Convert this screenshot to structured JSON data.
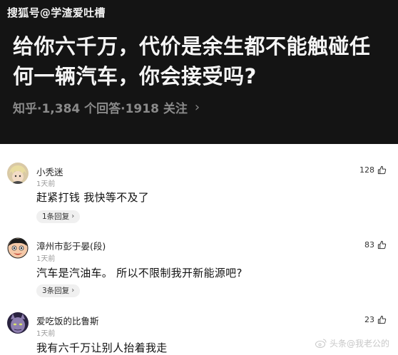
{
  "header": {
    "source_tag": "搜狐号@学渣爱吐槽",
    "question": "给你六千万，代价是余生都不能触碰任何一辆汽车，你会接受吗?",
    "meta": "知乎·1,384 个回答·1918 关注",
    "meta_chevron": "›"
  },
  "comments": [
    {
      "name": "小秃迷",
      "time": "1天前",
      "text": "赶紧打钱  我快等不及了",
      "replies": "1条回复",
      "likes": "128",
      "avatar": "avatar-blonde-anime"
    },
    {
      "name": "漳州市彭于晏(段)",
      "time": "1天前",
      "text": "汽车是汽油车。 所以不限制我开新能源吧?",
      "replies": "3条回复",
      "likes": "83",
      "avatar": "avatar-cartoon-face"
    },
    {
      "name": "爱吃饭的比鲁斯",
      "time": "1天前",
      "text": "我有六千万让别人抬着我走",
      "replies": "",
      "likes": "23",
      "avatar": "avatar-beerus"
    }
  ],
  "reply_chevron": "›",
  "watermark": "头条@我老公的",
  "icons": {
    "like": "thumbs-up-icon",
    "watermark": "weibo-logo-icon"
  }
}
